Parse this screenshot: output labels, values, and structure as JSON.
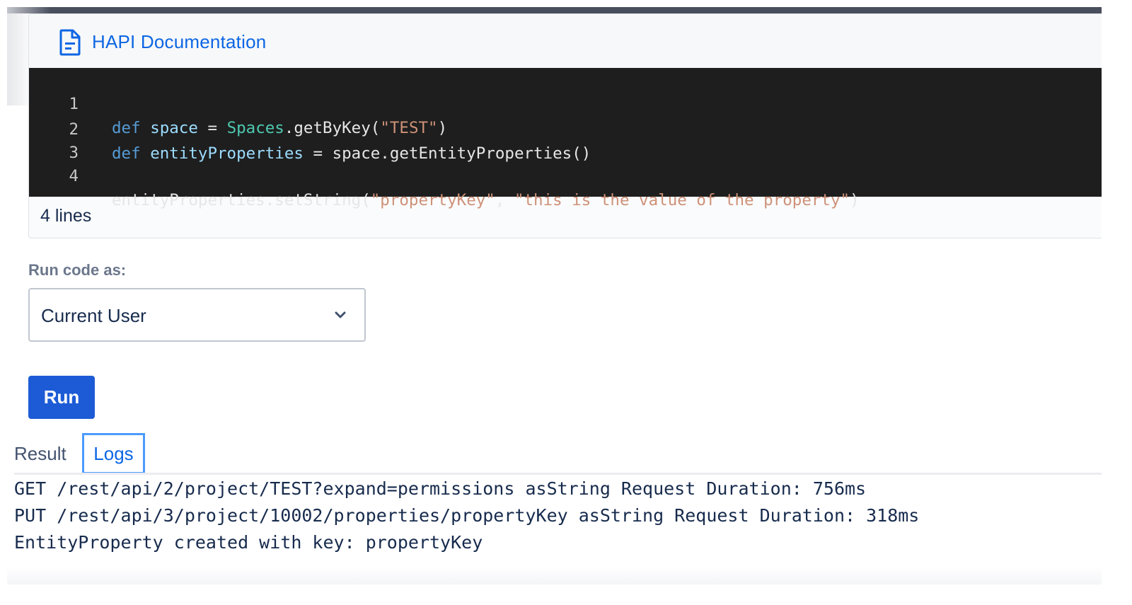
{
  "header": {
    "icon": "document-icon",
    "title": "HAPI Documentation"
  },
  "code": {
    "lines": [
      {
        "number": "1",
        "tokens": [
          {
            "t": "def",
            "c": "kw"
          },
          {
            "t": " ",
            "c": ""
          },
          {
            "t": "space",
            "c": "var"
          },
          {
            "t": " = ",
            "c": ""
          },
          {
            "t": "Spaces",
            "c": "cls"
          },
          {
            "t": ".getByKey(",
            "c": ""
          },
          {
            "t": "\"TEST\"",
            "c": "str"
          },
          {
            "t": ")",
            "c": ""
          }
        ]
      },
      {
        "number": "2",
        "tokens": [
          {
            "t": "def",
            "c": "kw"
          },
          {
            "t": " ",
            "c": ""
          },
          {
            "t": "entityProperties",
            "c": "var"
          },
          {
            "t": " = space.getEntityProperties()",
            "c": ""
          }
        ]
      },
      {
        "number": "3",
        "tokens": []
      },
      {
        "number": "4",
        "tokens": [
          {
            "t": "entityProperties.setString(",
            "c": ""
          },
          {
            "t": "\"propertyKey\"",
            "c": "str"
          },
          {
            "t": ", ",
            "c": ""
          },
          {
            "t": "\"this is the value of the property\"",
            "c": "str"
          },
          {
            "t": ")",
            "c": ""
          }
        ]
      }
    ],
    "footer": "4 lines"
  },
  "run_as": {
    "label": "Run code as:",
    "selected": "Current User"
  },
  "run_button": "Run",
  "tabs": [
    {
      "label": "Result",
      "active": false
    },
    {
      "label": "Logs",
      "active": true
    }
  ],
  "logs": [
    "GET /rest/api/2/project/TEST?expand=permissions asString Request Duration: 756ms",
    "PUT /rest/api/3/project/10002/properties/propertyKey asString Request Duration: 318ms",
    "EntityProperty created with key: propertyKey"
  ],
  "colors": {
    "accent": "#0c66e4",
    "button": "#1d5bd6",
    "code_bg": "#1e1e1e"
  }
}
